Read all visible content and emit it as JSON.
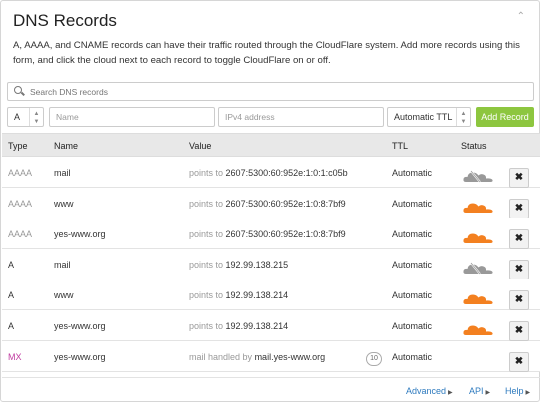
{
  "header": {
    "title": "DNS Records",
    "collapse_glyph": "⌃",
    "description": "A, AAAA, and CNAME records can have their traffic routed through the CloudFlare system. Add more records using this form, and click the cloud next to each record to toggle CloudFlare on or off."
  },
  "search": {
    "placeholder": "Search DNS records"
  },
  "add_form": {
    "type_value": "A",
    "name_placeholder": "Name",
    "value_placeholder": "IPv4 address",
    "ttl_value": "Automatic TTL",
    "add_label": "Add Record"
  },
  "columns": {
    "type": "Type",
    "name": "Name",
    "value": "Value",
    "ttl": "TTL",
    "status": "Status"
  },
  "records": [
    {
      "type": "AAAA",
      "name": "mail",
      "value_prefix": "points to",
      "value": "2607:5300:60:952e:1:0:1:c05b",
      "ttl": "Automatic",
      "proxied": false
    },
    {
      "type": "AAAA",
      "name": "www",
      "value_prefix": "points to",
      "value": "2607:5300:60:952e:1:0:8:7bf9",
      "ttl": "Automatic",
      "proxied": true
    },
    {
      "type": "AAAA",
      "name": "yes-www.org",
      "value_prefix": "points to",
      "value": "2607:5300:60:952e:1:0:8:7bf9",
      "ttl": "Automatic",
      "proxied": true
    },
    {
      "type": "A",
      "name": "mail",
      "value_prefix": "points to",
      "value": "192.99.138.215",
      "ttl": "Automatic",
      "proxied": false
    },
    {
      "type": "A",
      "name": "www",
      "value_prefix": "points to",
      "value": "192.99.138.214",
      "ttl": "Automatic",
      "proxied": true
    },
    {
      "type": "A",
      "name": "yes-www.org",
      "value_prefix": "points to",
      "value": "192.99.138.214",
      "ttl": "Automatic",
      "proxied": true
    },
    {
      "type": "MX",
      "name": "yes-www.org",
      "value_prefix": "mail handled by",
      "value": "mail.yes-www.org",
      "priority": "10",
      "ttl": "Automatic"
    }
  ],
  "delete_glyph": "✖",
  "footer": {
    "advanced": "Advanced",
    "api": "API",
    "help": "Help"
  },
  "colors": {
    "accent_green": "#8dc63f",
    "cloud_on": "#f38020",
    "cloud_off": "#999999",
    "mx_type": "#c03aa0",
    "link": "#2f7bbf"
  }
}
